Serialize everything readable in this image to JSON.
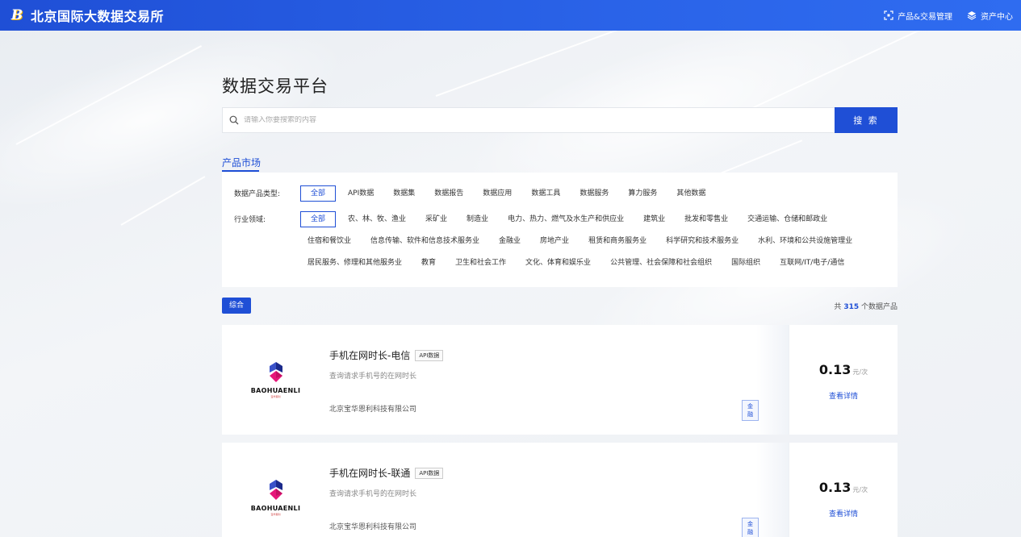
{
  "header": {
    "brand_logo": "B",
    "brand_name": "北京国际大数据交易所",
    "links": [
      {
        "label": "产品&交易管理",
        "icon": "scan-icon"
      },
      {
        "label": "资产中心",
        "icon": "layers-icon"
      }
    ]
  },
  "page": {
    "title": "数据交易平台",
    "search": {
      "placeholder": "请输入你要搜索的内容",
      "button": "搜 索"
    },
    "section_tab": "产品市场"
  },
  "filters": {
    "type": {
      "label": "数据产品类型:",
      "options": [
        "全部",
        "API数据",
        "数据集",
        "数据报告",
        "数据应用",
        "数据工具",
        "数据服务",
        "算力服务",
        "其他数据"
      ],
      "active": 0
    },
    "industry": {
      "label": "行业领域:",
      "options": [
        "全部",
        "农、林、牧、渔业",
        "采矿业",
        "制造业",
        "电力、热力、燃气及水生产和供应业",
        "建筑业",
        "批发和零售业",
        "交通运输、仓储和邮政业",
        "住宿和餐饮业",
        "信息传输、软件和信息技术服务业",
        "金融业",
        "房地产业",
        "租赁和商务服务业",
        "科学研究和技术服务业",
        "水利、环境和公共设施管理业",
        "居民服务、修理和其他服务业",
        "教育",
        "卫生和社会工作",
        "文化、体育和娱乐业",
        "公共管理、社会保障和社会组织",
        "国际组织",
        "互联网/IT/电子/通信"
      ],
      "active": 0
    }
  },
  "results": {
    "sort_label": "综合",
    "total_prefix": "共",
    "total_count": "315",
    "total_suffix": "个数据产品"
  },
  "products": [
    {
      "logo_text": "BAOHUAENLI",
      "logo_sub": "宝华恩利",
      "name": "手机在网时长-电信",
      "tag": "API数据",
      "desc": "查询请求手机号的在网时长",
      "company": "北京宝华恩利科技有限公司",
      "industry": "金融",
      "price": "0.13",
      "unit": "元/次",
      "detail": "查看详情"
    },
    {
      "logo_text": "BAOHUAENLI",
      "logo_sub": "宝华恩利",
      "name": "手机在网时长-联通",
      "tag": "API数据",
      "desc": "查询请求手机号的在网时长",
      "company": "北京宝华恩利科技有限公司",
      "industry": "金融",
      "price": "0.13",
      "unit": "元/次",
      "detail": "查看详情"
    }
  ],
  "colors": {
    "primary": "#1f4fd6",
    "header_gradient_start": "#1f4fd6",
    "header_gradient_end": "#2f6cf0",
    "background": "#eef1f5"
  }
}
